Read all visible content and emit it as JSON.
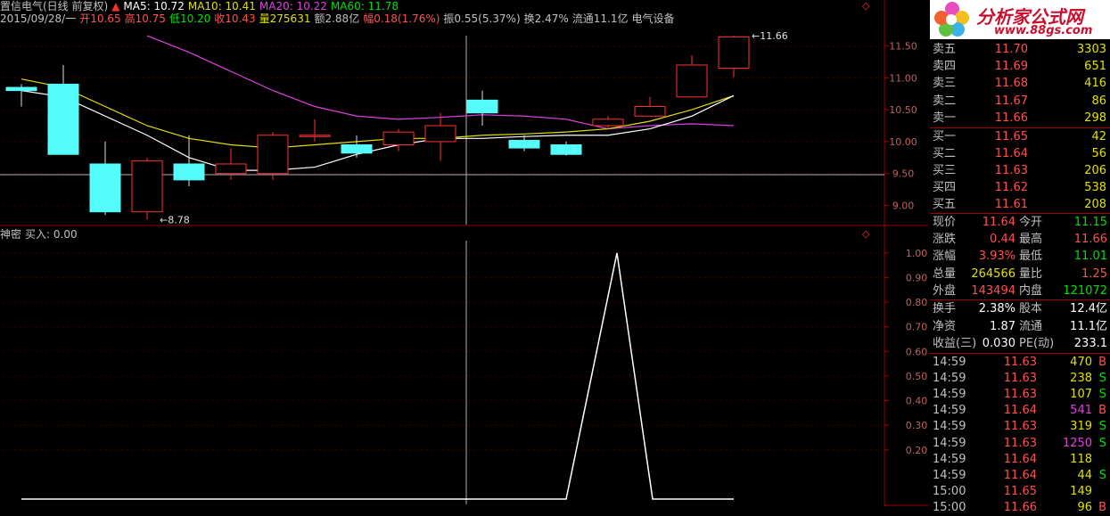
{
  "header": {
    "stock": "置信电气(日线 前复权)",
    "ma5": "MA5: 10.72",
    "ma10": "MA10: 10.41",
    "ma20": "MA20: 10.22",
    "ma60": "MA60: 11.78",
    "date": "2015/09/28/一",
    "open": "开10.65",
    "high": "高10.75",
    "low": "低10.20",
    "close": "收10.43",
    "volume": "量275631",
    "amount": "额2.88亿",
    "change": "幅0.18(1.76%)",
    "amplitude": "振0.55(5.37%)",
    "turnover": "换2.47%",
    "float": "流通11.1亿",
    "sector": "电气设备"
  },
  "indicator": {
    "label": "神密",
    "value": "买入: 0.00"
  },
  "colors": {
    "up": "#ff3030",
    "down": "#54fcfc",
    "ma5": "#ffffff",
    "ma10": "#e0e000",
    "ma20": "#e040e0",
    "ma60": "#00e000",
    "border": "#a00000"
  },
  "chart_data": [
    {
      "type": "candlestick",
      "ylim": [
        8.7,
        11.8
      ],
      "yticks": [
        "11.50",
        "11.00",
        "10.50",
        "10.00",
        "9.50",
        "9.00"
      ],
      "annotations": {
        "high": "11.66",
        "low": "8.78"
      },
      "candles": [
        {
          "o": 10.85,
          "h": 10.9,
          "l": 10.55,
          "c": 10.8
        },
        {
          "o": 10.9,
          "h": 11.2,
          "l": 9.8,
          "c": 9.8
        },
        {
          "o": 9.65,
          "h": 10.0,
          "l": 8.85,
          "c": 8.9
        },
        {
          "o": 8.9,
          "h": 9.75,
          "l": 8.78,
          "c": 9.7
        },
        {
          "o": 9.65,
          "h": 10.1,
          "l": 9.3,
          "c": 9.4
        },
        {
          "o": 9.5,
          "h": 9.9,
          "l": 9.4,
          "c": 9.65
        },
        {
          "o": 9.5,
          "h": 10.15,
          "l": 9.4,
          "c": 10.1
        },
        {
          "o": 10.1,
          "h": 10.35,
          "l": 10.0,
          "c": 10.1
        },
        {
          "o": 9.95,
          "h": 10.1,
          "l": 9.75,
          "c": 9.82
        },
        {
          "o": 9.95,
          "h": 10.2,
          "l": 9.85,
          "c": 10.15
        },
        {
          "o": 10.0,
          "h": 10.45,
          "l": 9.7,
          "c": 10.25
        },
        {
          "o": 10.65,
          "h": 10.8,
          "l": 10.25,
          "c": 10.45
        },
        {
          "o": 10.02,
          "h": 10.1,
          "l": 9.85,
          "c": 9.9
        },
        {
          "o": 9.95,
          "h": 10.0,
          "l": 9.78,
          "c": 9.8
        },
        {
          "o": 10.25,
          "h": 10.4,
          "l": 10.2,
          "c": 10.35
        },
        {
          "o": 10.4,
          "h": 10.7,
          "l": 10.4,
          "c": 10.55
        },
        {
          "o": 10.7,
          "h": 11.35,
          "l": 10.7,
          "c": 11.2
        },
        {
          "o": 11.15,
          "h": 11.66,
          "l": 11.01,
          "c": 11.64
        }
      ],
      "ma10": [
        10.98,
        10.85,
        10.55,
        10.25,
        10.05,
        9.95,
        9.9,
        9.95,
        10.0,
        10.05,
        10.05,
        10.1,
        10.12,
        10.15,
        10.2,
        10.32,
        10.5,
        10.72
      ],
      "ma20": [
        null,
        null,
        null,
        11.66,
        11.4,
        11.1,
        10.8,
        10.55,
        10.4,
        10.35,
        10.38,
        10.42,
        10.4,
        10.35,
        10.2,
        10.25,
        10.28,
        10.25
      ],
      "ma5": [
        10.8,
        10.7,
        10.4,
        10.1,
        9.75,
        9.55,
        9.55,
        9.6,
        9.8,
        9.95,
        10.05,
        10.05,
        10.08,
        10.1,
        10.1,
        10.2,
        10.4,
        10.72
      ]
    },
    {
      "type": "line",
      "name": "神密",
      "ylim": [
        0,
        1.05
      ],
      "yticks": [
        "1.00",
        "0.90",
        "0.80",
        "0.70",
        "0.60",
        "0.50",
        "0.40",
        "0.30",
        "0.20"
      ],
      "values": [
        0,
        0,
        0,
        0,
        0,
        0,
        0,
        0,
        0,
        0,
        0,
        0,
        0,
        0,
        1,
        0,
        0,
        0
      ]
    }
  ],
  "quotes": {
    "asks": [
      {
        "label": "卖五",
        "price": "11.70",
        "vol": "3303"
      },
      {
        "label": "卖四",
        "price": "11.69",
        "vol": "651"
      },
      {
        "label": "卖三",
        "price": "11.68",
        "vol": "416"
      },
      {
        "label": "卖二",
        "price": "11.67",
        "vol": "86"
      },
      {
        "label": "卖一",
        "price": "11.66",
        "vol": "298"
      }
    ],
    "bids": [
      {
        "label": "买一",
        "price": "11.65",
        "vol": "42"
      },
      {
        "label": "买二",
        "price": "11.64",
        "vol": "56"
      },
      {
        "label": "买三",
        "price": "11.63",
        "vol": "206"
      },
      {
        "label": "买四",
        "price": "11.62",
        "vol": "538"
      },
      {
        "label": "买五",
        "price": "11.61",
        "vol": "208"
      }
    ],
    "stats": [
      {
        "l1": "现价",
        "v1": "11.64",
        "c1": "red",
        "l2": "今开",
        "v2": "11.15",
        "c2": "green"
      },
      {
        "l1": "涨跌",
        "v1": "0.44",
        "c1": "red",
        "l2": "最高",
        "v2": "11.66",
        "c2": "red"
      },
      {
        "l1": "涨幅",
        "v1": "3.93%",
        "c1": "red",
        "l2": "最低",
        "v2": "11.01",
        "c2": "green"
      },
      {
        "l1": "总量",
        "v1": "264566",
        "c1": "yellow",
        "l2": "量比",
        "v2": "1.25",
        "c2": "red"
      },
      {
        "l1": "外盘",
        "v1": "143494",
        "c1": "red",
        "l2": "内盘",
        "v2": "121072",
        "c2": "green"
      },
      {
        "l1": "换手",
        "v1": "2.38%",
        "c1": "white",
        "l2": "股本",
        "v2": "12.4亿",
        "c2": "white"
      },
      {
        "l1": "净资",
        "v1": "1.87",
        "c1": "white",
        "l2": "流通",
        "v2": "11.1亿",
        "c2": "white"
      },
      {
        "l1": "收益(三)",
        "v1": "0.030",
        "c1": "white",
        "l2": "PE(动)",
        "v2": "233.1",
        "c2": "white"
      }
    ],
    "ticks": [
      {
        "time": "14:59",
        "price": "11.63",
        "vol": "470",
        "vc": "yellow",
        "bs": "B",
        "bc": "red"
      },
      {
        "time": "14:59",
        "price": "11.63",
        "vol": "238",
        "vc": "yellow",
        "bs": "S",
        "bc": "green"
      },
      {
        "time": "14:59",
        "price": "11.63",
        "vol": "107",
        "vc": "yellow",
        "bs": "S",
        "bc": "green"
      },
      {
        "time": "14:59",
        "price": "11.64",
        "vol": "541",
        "vc": "purple",
        "bs": "B",
        "bc": "red"
      },
      {
        "time": "14:59",
        "price": "11.63",
        "vol": "319",
        "vc": "yellow",
        "bs": "S",
        "bc": "green"
      },
      {
        "time": "14:59",
        "price": "11.63",
        "vol": "1250",
        "vc": "purple",
        "bs": "S",
        "bc": "green"
      },
      {
        "time": "14:59",
        "price": "11.64",
        "vol": "118",
        "vc": "yellow",
        "bs": "",
        "bc": "red"
      },
      {
        "time": "14:59",
        "price": "11.64",
        "vol": "44",
        "vc": "yellow",
        "bs": "S",
        "bc": "green"
      },
      {
        "time": "15:00",
        "price": "11.65",
        "vol": "149",
        "vc": "yellow",
        "bs": "",
        "bc": "red"
      },
      {
        "time": "15:00",
        "price": "11.66",
        "vol": "96",
        "vc": "yellow",
        "bs": "B",
        "bc": "red"
      }
    ]
  },
  "logo": {
    "title": "分析家公式网",
    "url": "www.88gs.com"
  }
}
